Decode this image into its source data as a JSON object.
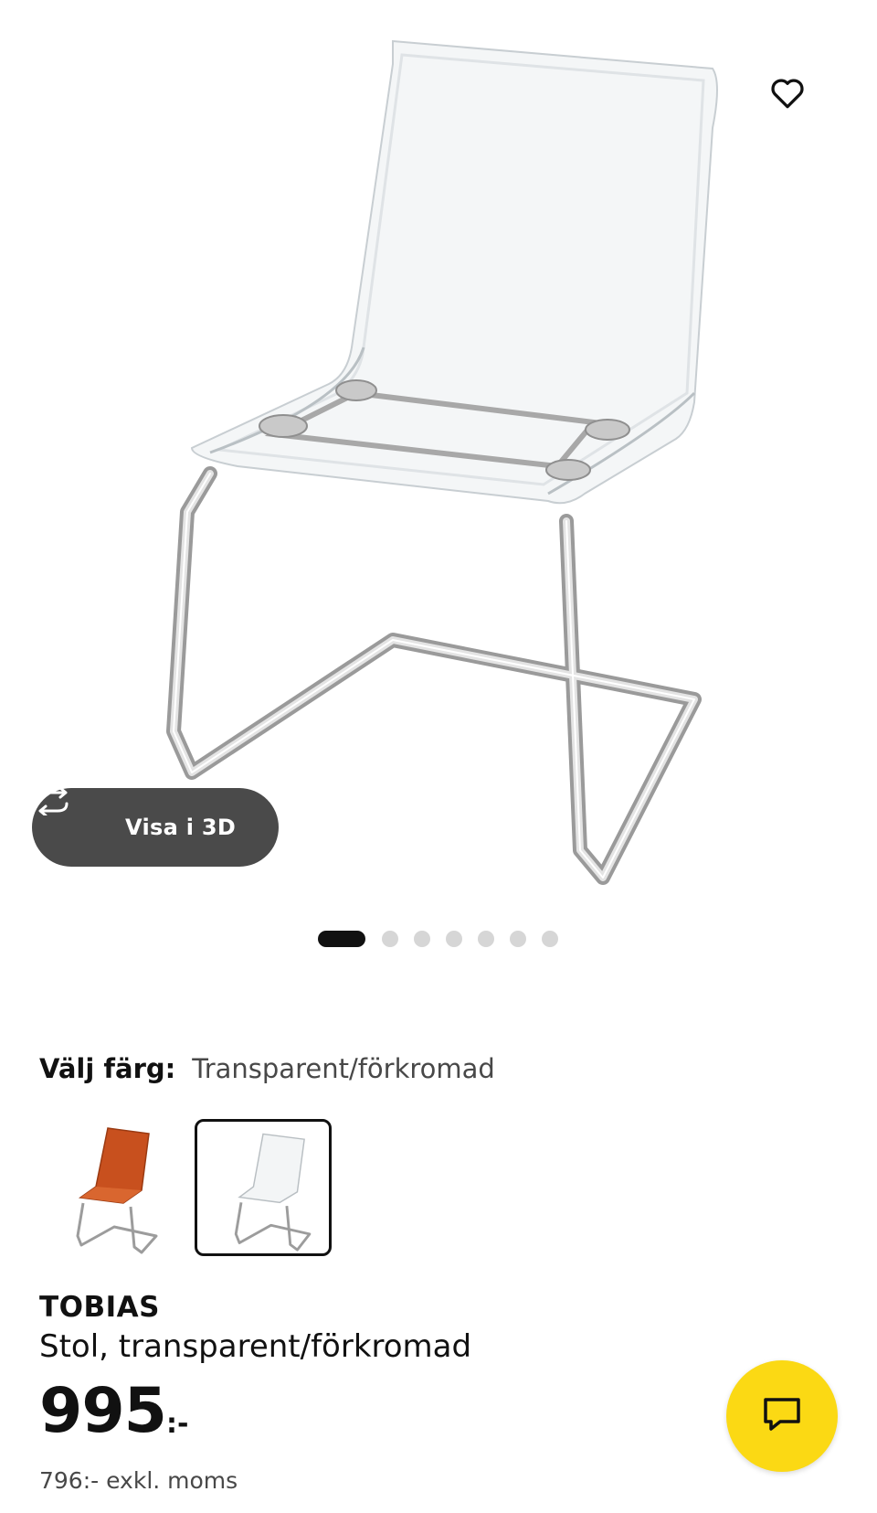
{
  "gallery": {
    "view_3d_label": "Visa i 3D",
    "image_count": 7,
    "active_index": 0
  },
  "color_picker": {
    "label": "Välj färg:",
    "selected_value": "Transparent/förkromad",
    "options": [
      {
        "name": "orange-chair-swatch",
        "selected": false
      },
      {
        "name": "transparent-chair-swatch",
        "selected": true
      }
    ]
  },
  "product": {
    "name": "TOBIAS",
    "description": "Stol, transparent/förkromad",
    "price": "995",
    "price_suffix": ":-",
    "price_excl_vat": "796:- exkl. moms"
  },
  "colors": {
    "chat_button": "#FBD914",
    "button_3d_bg": "#4a4a4a",
    "swatch_orange": "#C8501E"
  },
  "icons": [
    "scroll-indicator",
    "heart-icon",
    "rotate-3d-icon",
    "chat-icon"
  ]
}
